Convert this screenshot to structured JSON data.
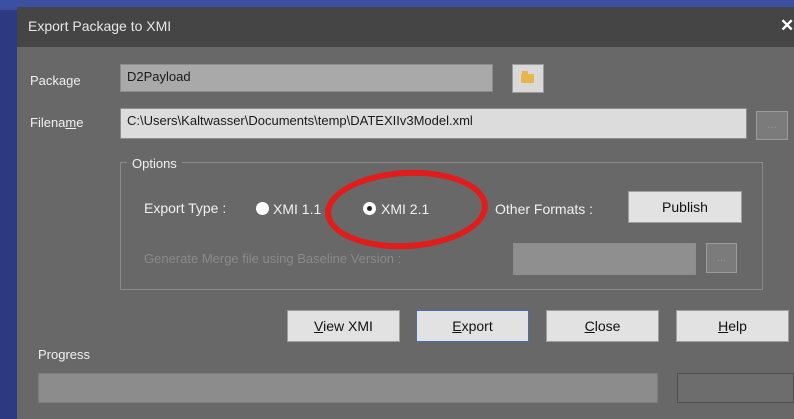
{
  "window": {
    "title": "Export Package to XMI",
    "close_glyph": "✕"
  },
  "package": {
    "label": "Package",
    "value": "D2Payload"
  },
  "filename": {
    "label_prefix": "Filena",
    "label_underline": "m",
    "label_suffix": "e",
    "value": "C:\\Users\\Kaltwasser\\Documents\\temp\\DATEXIIv3Model.xml",
    "browse_label": "..."
  },
  "options": {
    "legend": "Options",
    "export_type_label": "Export Type :",
    "radio_xmi11": {
      "label": "XMI 1.1",
      "selected": false
    },
    "radio_xmi21": {
      "label": "XMI 2.1",
      "selected": true
    },
    "other_formats_label": "Other Formats :",
    "publish_label": "Publish",
    "merge_label": "Generate Merge file using Baseline Version :",
    "merge_value": "",
    "merge_browse_label": "..."
  },
  "buttons": {
    "view_xmi": {
      "underline": "V",
      "rest": "iew XMI"
    },
    "export": {
      "underline": "E",
      "rest": "xport"
    },
    "close": {
      "underline": "C",
      "rest": "lose"
    },
    "help": {
      "underline": "H",
      "rest": "elp"
    }
  },
  "progress": {
    "label": "Progress",
    "value": ""
  },
  "colors": {
    "highlight_ellipse": "#e21b1b",
    "dialog_bg": "#686868",
    "titlebar_bg": "#454545"
  },
  "icons": {
    "folder": "folder-icon",
    "close": "close-icon"
  }
}
